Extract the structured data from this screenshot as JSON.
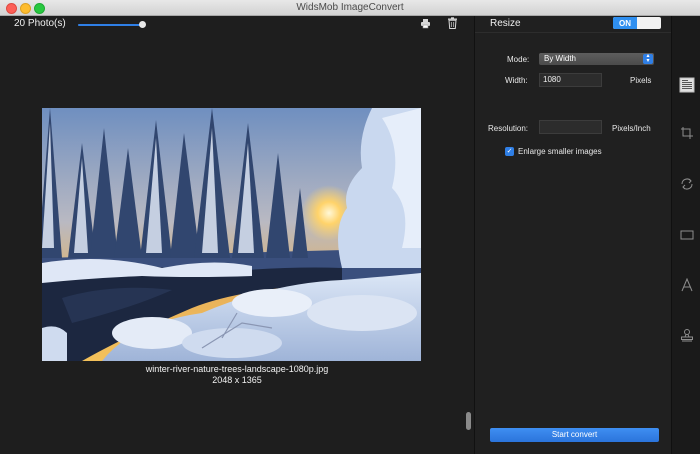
{
  "window": {
    "title": "WidsMob ImageConvert"
  },
  "toolbar": {
    "photo_count": "20 Photo(s)",
    "zoom_level": 0.97,
    "icons": [
      "print-icon",
      "trash-icon"
    ]
  },
  "preview": {
    "file_name": "winter-river-nature-trees-landscape-1080p.jpg",
    "dimensions": "2048 x 1365",
    "image_subject": "snowy winter river forest at sunset"
  },
  "resize": {
    "title": "Resize",
    "toggle_label": "ON",
    "mode_label": "Mode:",
    "mode_value": "By Width",
    "width_label": "Width:",
    "width_value": "1080",
    "width_unit": "Pixels",
    "resolution_label": "Resolution:",
    "resolution_value": "",
    "resolution_unit": "Pixels/Inch",
    "enlarge_label": "Enlarge smaller images",
    "enlarge_checked": true
  },
  "actions": {
    "start_convert": "Start convert"
  },
  "sidebar": {
    "icons": [
      "resize-icon",
      "crop-icon",
      "rotate-icon",
      "border-icon",
      "watermark-icon",
      "stamp-icon"
    ]
  },
  "colors": {
    "accent": "#2f7fe6",
    "background": "#1e1e1e"
  }
}
